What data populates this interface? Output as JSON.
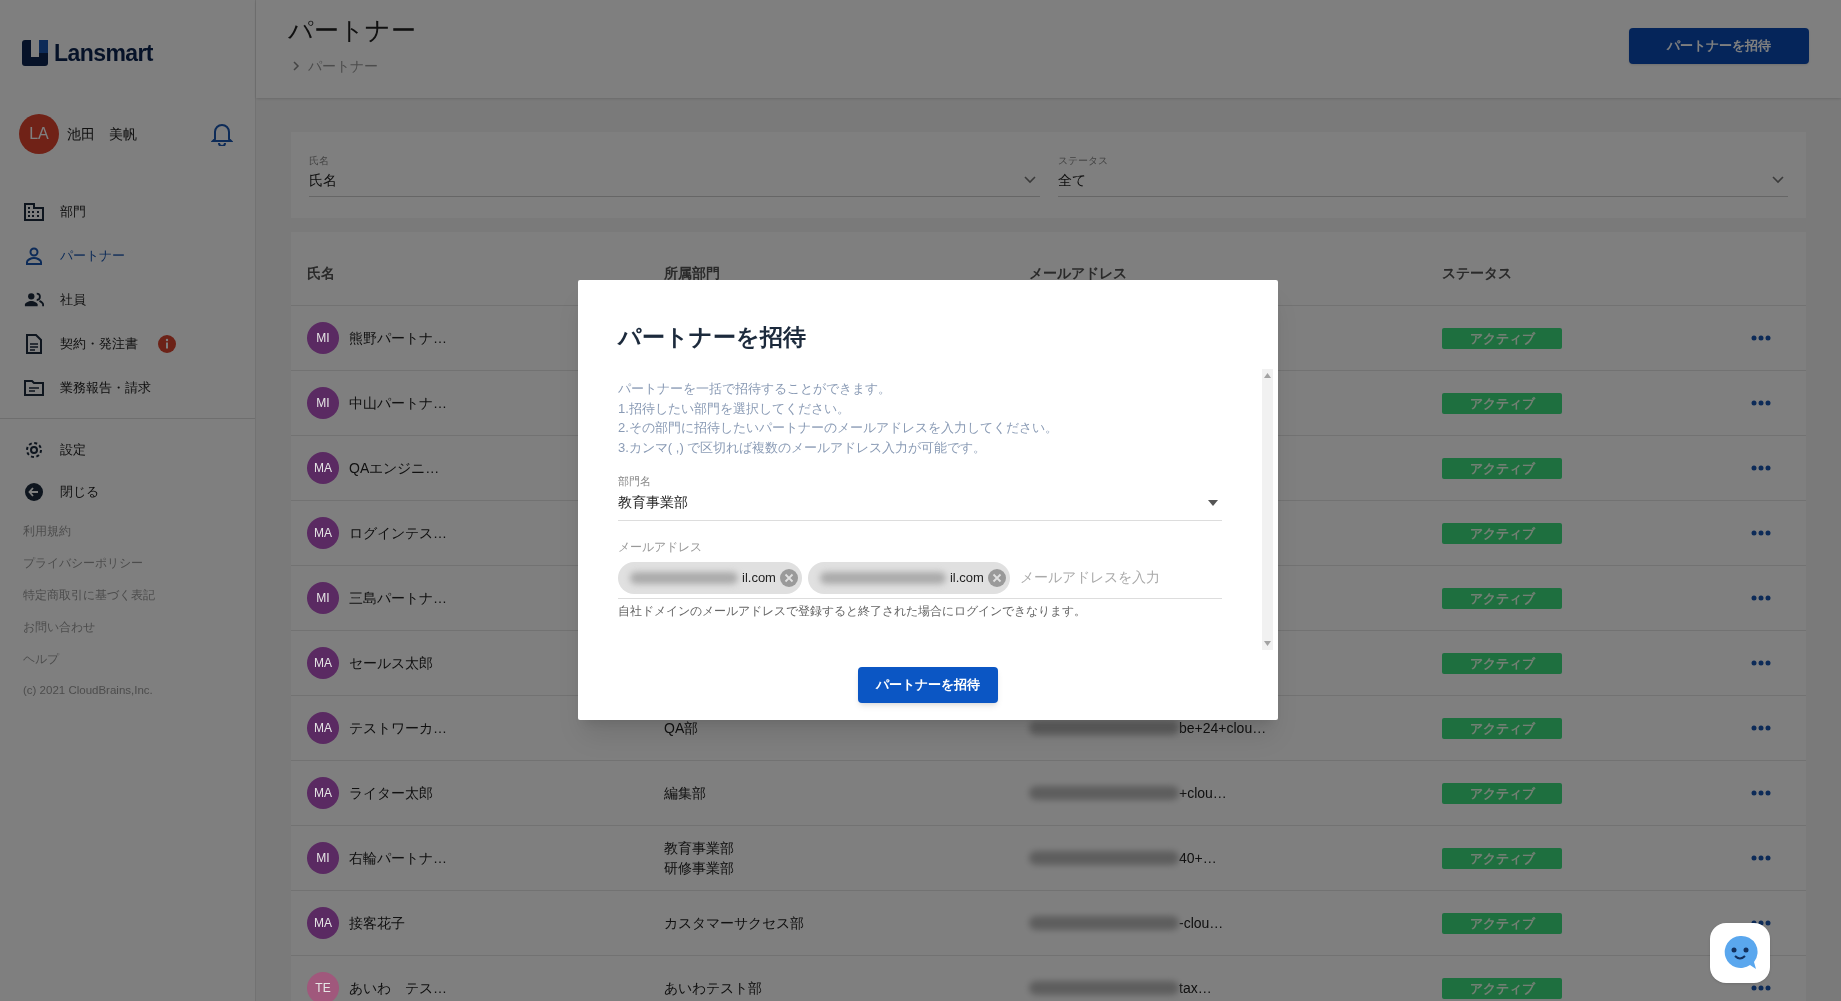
{
  "brand": {
    "name": "Lansmart"
  },
  "user": {
    "initials": "LA",
    "name": "池田　美帆"
  },
  "nav": [
    {
      "kind": "building",
      "label": "部門",
      "selected": false,
      "alert": false
    },
    {
      "kind": "person",
      "label": "パートナー",
      "selected": true,
      "alert": false
    },
    {
      "kind": "people",
      "label": "社員",
      "selected": false,
      "alert": false
    },
    {
      "kind": "document",
      "label": "契約・発注書",
      "selected": false,
      "alert": true
    },
    {
      "kind": "folder",
      "label": "業務報告・請求",
      "selected": false,
      "alert": false
    }
  ],
  "nav_bottom": [
    {
      "kind": "gear",
      "label": "設定"
    },
    {
      "kind": "back",
      "label": "閉じる"
    }
  ],
  "footer_links": [
    "利用規約",
    "プライバシーポリシー",
    "特定商取引に基づく表記",
    "お問い合わせ",
    "ヘルプ"
  ],
  "copyright": "(c) 2021 CloudBrains,Inc.",
  "page": {
    "title": "パートナー",
    "breadcrumb": "パートナー",
    "invite_button": "パートナーを招待"
  },
  "filters": [
    {
      "label": "氏名",
      "value": "氏名"
    },
    {
      "label": "ステータス",
      "value": "全て"
    }
  ],
  "table": {
    "columns": [
      "氏名",
      "所属部門",
      "メールアドレス",
      "ステータス"
    ],
    "rows": [
      {
        "initials": "MI",
        "color": "#5a2a62",
        "name": "熊野パートナ…",
        "status": "アクティブ"
      },
      {
        "initials": "MI",
        "color": "#5a2a62",
        "name": "中山パートナ…",
        "status": "アクティブ"
      },
      {
        "initials": "MA",
        "color": "#5a2a62",
        "name": "QAエンジニ…",
        "status": "アクティブ"
      },
      {
        "initials": "MA",
        "color": "#5a2a62",
        "name": "ログインテス…",
        "status": "アクティブ"
      },
      {
        "initials": "MI",
        "color": "#5a2a62",
        "name": "三島パートナ…",
        "status": "アクティブ"
      },
      {
        "initials": "MA",
        "color": "#5a2a62",
        "name": "セールス太郎",
        "status": "アクティブ"
      },
      {
        "initials": "MA",
        "color": "#5a2a62",
        "name": "テストワーカ…",
        "departments": [
          "QA部"
        ],
        "email": "be+24+clou…",
        "status": "アクティブ"
      },
      {
        "initials": "MA",
        "color": "#5a2a62",
        "name": "ライター太郎",
        "departments": [
          "編集部"
        ],
        "email": "+clou…",
        "status": "アクティブ"
      },
      {
        "initials": "MI",
        "color": "#5a2a62",
        "name": "右輪パートナ…",
        "departments": [
          "教育事業部",
          "研修事業部"
        ],
        "email": "40+…",
        "status": "アクティブ"
      },
      {
        "initials": "MA",
        "color": "#5a2a62",
        "name": "接客花子",
        "departments": [
          "カスタマーサクセス部"
        ],
        "email": "-clou…",
        "status": "アクティブ"
      },
      {
        "initials": "TE",
        "color": "#a0587c",
        "name": "あいわ　テス…",
        "departments": [
          "あいわテスト部"
        ],
        "email": "tax…",
        "status": "アクティブ"
      }
    ]
  },
  "dialog": {
    "title": "パートナーを招待",
    "instructions": [
      "パートナーを一括で招待することができます。",
      "1.招待したい部門を選択してください。",
      "2.その部門に招待したいパートナーのメールアドレスを入力してください。",
      "3.カンマ( ,) で区切れば複数のメールアドレス入力が可能です。"
    ],
    "department": {
      "label": "部門名",
      "value": "教育事業部"
    },
    "email": {
      "label": "メールアドレス",
      "chips": [
        "il.com",
        "il.com"
      ],
      "placeholder": "メールアドレスを入力"
    },
    "hint": "自社ドメインのメールアドレスで登録すると終了された場合にログインできなります。",
    "submit": "パートナーを招待"
  }
}
